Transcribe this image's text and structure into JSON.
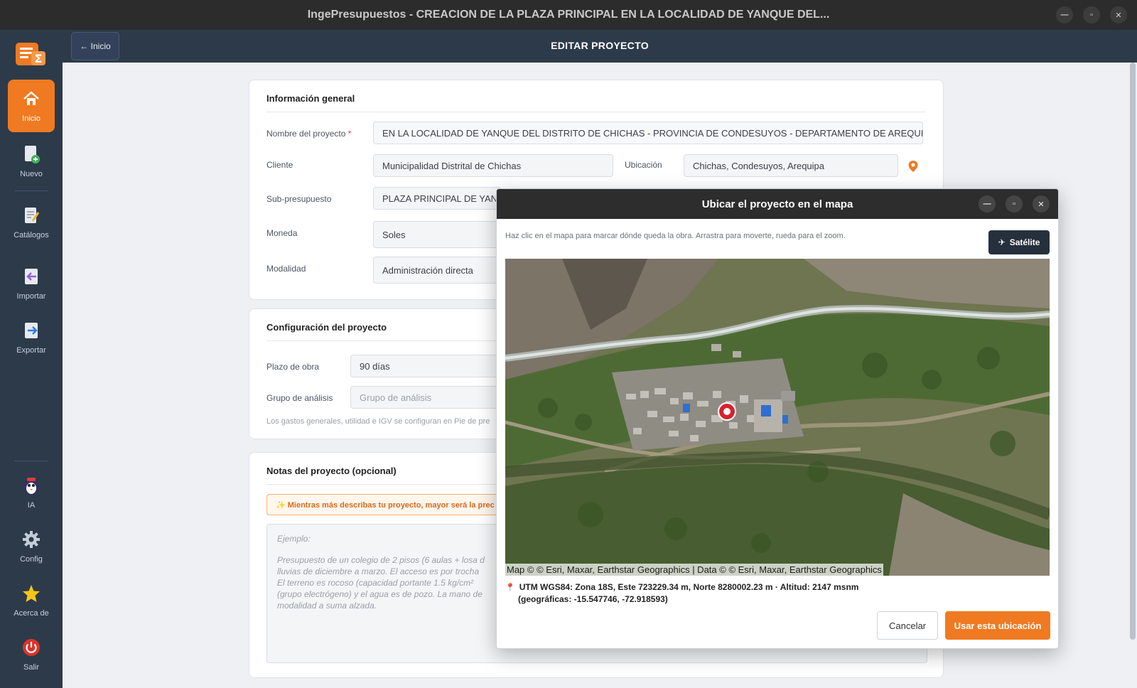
{
  "window": {
    "title": "IngePresupuestos  -  CREACION DE LA PLAZA PRINCIPAL EN LA LOCALIDAD DE YANQUE DEL...",
    "controls": [
      "minimize-icon",
      "maximize-icon",
      "close-icon"
    ]
  },
  "sidebar": {
    "items": [
      {
        "label": "Inicio",
        "icon": "home-icon",
        "active": true
      },
      {
        "label": "Nuevo",
        "icon": "new-document-icon"
      },
      {
        "label": "Catálogos",
        "icon": "catalog-icon"
      },
      {
        "label": "Importar",
        "icon": "import-icon"
      },
      {
        "label": "Exportar",
        "icon": "export-icon"
      },
      {
        "label": "IA",
        "icon": "ai-bot-icon"
      },
      {
        "label": "Config",
        "icon": "gear-icon"
      },
      {
        "label": "Acerca de",
        "icon": "star-icon"
      },
      {
        "label": "Salir",
        "icon": "power-icon"
      }
    ]
  },
  "header": {
    "back_label": "← Inicio",
    "title": "EDITAR PROYECTO"
  },
  "general": {
    "title": "Información general",
    "project_name_label": "Nombre del proyecto",
    "required_mark": "*",
    "project_name_value": "EN LA LOCALIDAD DE YANQUE DEL DISTRITO DE CHICHAS - PROVINCIA DE CONDESUYOS - DEPARTAMENTO DE AREQUIPA",
    "client_label": "Cliente",
    "client_value": "Municipalidad Distrital de Chichas",
    "location_label": "Ubicación",
    "location_value": "Chichas, Condesuyos, Arequipa",
    "subbudget_label": "Sub-presupuesto",
    "subbudget_value": "PLAZA PRINCIPAL DE YAN",
    "currency_label": "Moneda",
    "currency_value": "Soles",
    "modality_label": "Modalidad",
    "modality_value": "Administración directa"
  },
  "config": {
    "title": "Configuración del proyecto",
    "term_label": "Plazo de obra",
    "term_value": "90 días",
    "group_label": "Grupo de análisis",
    "group_placeholder": "Grupo de análisis",
    "note": "Los gastos generales, utilidad e IGV se configuran en Pie de pre"
  },
  "notes": {
    "title": "Notas del proyecto  (opcional)",
    "tip": "✨ Mientras más describas tu proyecto, mayor será la prec",
    "example_label": "Ejemplo:",
    "example_lines": [
      "Presupuesto de un colegio de 2 pisos (6 aulas + losa d",
      "lluvias de diciembre a marzo. El acceso es por trocha",
      "El terreno es rocoso (capacidad portante 1.5 kg/cm²",
      "(grupo electrógeno) y el agua es de pozo. La mano de",
      "modalidad a suma alzada."
    ]
  },
  "modal": {
    "title": "Ubicar el proyecto en el mapa",
    "hint": "Haz clic en el mapa para marcar dónde queda la obra. Arrastra para moverte, rueda para el zoom.",
    "satellite_label": "Satélite",
    "attribution": "Map © © Esri, Maxar, Earthstar Geographics | Data © © Esri, Maxar, Earthstar Geographics",
    "coords_line1": "UTM WGS84:  Zona 18S, Este 723229.34 m, Norte 8280002.23 m · Altitud: 2147 msnm",
    "coords_line2": "(geográficas: -15.547746, -72.918593)",
    "cancel_label": "Cancelar",
    "use_label": "Usar esta ubicación"
  },
  "colors": {
    "accent": "#f07a22",
    "sidebar": "#2d3a4a",
    "marker": "#d6232f"
  }
}
